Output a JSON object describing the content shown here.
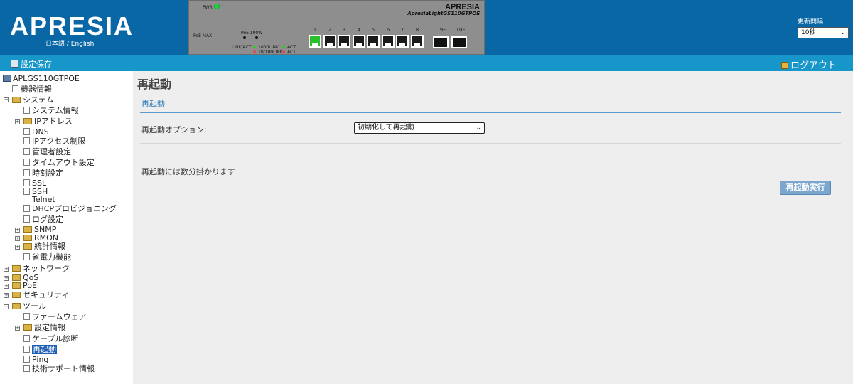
{
  "header": {
    "logo": "APRESIA",
    "lang_ja": "日本語",
    "lang_sep": " / ",
    "lang_en": "English",
    "refresh_label": "更新間隔",
    "refresh_value": "10秒"
  },
  "device_panel": {
    "brand": "APRESIA",
    "model": "ApresiaLightGS110GTPOE",
    "pwr": "PWR",
    "poe_max": "PoE MAX",
    "poe_100w": "PoE 100W",
    "led_legend": [
      "LINK/ACT",
      "1000LINK",
      "ACT",
      "10/100LINK",
      "ACT"
    ],
    "ports": [
      "1",
      "2",
      "3",
      "4",
      "5",
      "6",
      "7",
      "8"
    ],
    "sfp_ports": [
      "9F",
      "10F"
    ],
    "active_port": "1",
    "colors": {
      "led_on": "#2bd12b",
      "port": "#1a1a1a"
    }
  },
  "toolbar": {
    "save_label": "設定保存",
    "logout_label": "ログアウト"
  },
  "sidebar": {
    "root": "APLGS110GTPOE",
    "items": [
      {
        "label": "機器情報"
      },
      {
        "label": "システム"
      },
      {
        "label": "システム情報"
      },
      {
        "label": "IPアドレス"
      },
      {
        "label": "DNS"
      },
      {
        "label": "IPアクセス制限"
      },
      {
        "label": "管理者設定"
      },
      {
        "label": "タイムアウト設定"
      },
      {
        "label": "時刻設定"
      },
      {
        "label": "SSL"
      },
      {
        "label": "SSH"
      },
      {
        "label": "Telnet"
      },
      {
        "label": "DHCPプロビジョニング"
      },
      {
        "label": "ログ設定"
      },
      {
        "label": "SNMP"
      },
      {
        "label": "RMON"
      },
      {
        "label": "統計情報"
      },
      {
        "label": "省電力機能"
      },
      {
        "label": "ネットワーク"
      },
      {
        "label": "QoS"
      },
      {
        "label": "PoE"
      },
      {
        "label": "セキュリティ"
      },
      {
        "label": "ツール"
      },
      {
        "label": "ファームウェア"
      },
      {
        "label": "設定情報"
      },
      {
        "label": "ケーブル診断"
      },
      {
        "label": "再起動"
      },
      {
        "label": "Ping"
      },
      {
        "label": "技術サポート情報"
      }
    ]
  },
  "main": {
    "title": "再起動",
    "section_title": "再起動",
    "option_label": "再起動オプション:",
    "option_value": "初期化して再起動",
    "note": "再起動には数分掛かります",
    "exec_button": "再起動実行"
  }
}
